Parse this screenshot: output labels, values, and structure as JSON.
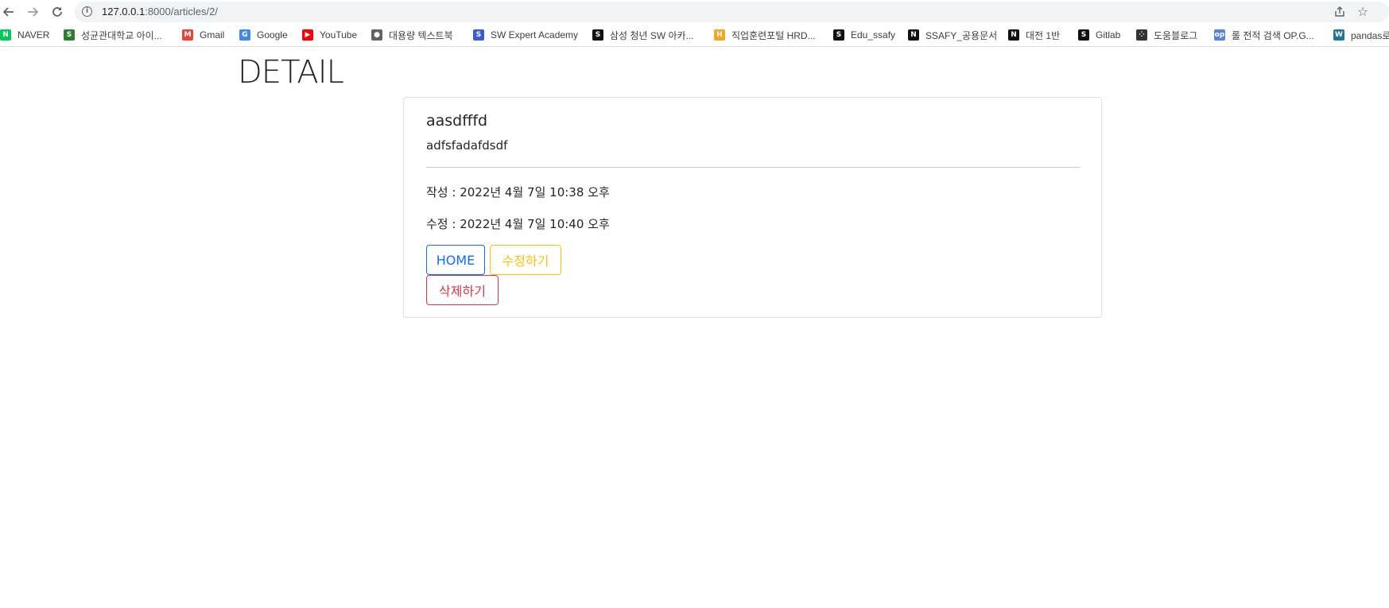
{
  "browser": {
    "url_host": "127.0.0.1",
    "url_path": ":8000/articles/2/",
    "bookmarks": [
      {
        "label": "NAVER",
        "icon": "naver-icon",
        "color": "#03c75a",
        "glyph": "N"
      },
      {
        "label": "성균관대학교 아이...",
        "icon": "skku-icon",
        "color": "#2e7d32",
        "glyph": "S"
      },
      {
        "label": "Gmail",
        "icon": "gmail-icon",
        "color": "#ea4335",
        "glyph": "M"
      },
      {
        "label": "Google",
        "icon": "google-icon",
        "color": "#4285f4",
        "glyph": "G"
      },
      {
        "label": "YouTube",
        "icon": "youtube-icon",
        "color": "#ff0000",
        "glyph": "▶"
      },
      {
        "label": "대용량 텍스트북",
        "icon": "globe-icon",
        "color": "#5f6368",
        "glyph": "●"
      },
      {
        "label": "SW Expert Academy",
        "icon": "swea-icon",
        "color": "#3b5bdb",
        "glyph": "S"
      },
      {
        "label": "삼성 청년 SW 아카...",
        "icon": "ssafy-icon",
        "color": "#111111",
        "glyph": "S"
      },
      {
        "label": "직업훈련포털 HRD...",
        "icon": "hrd-icon",
        "color": "#f5a623",
        "glyph": "H"
      },
      {
        "label": "Edu_ssafy",
        "icon": "edu-ssafy-icon",
        "color": "#111111",
        "glyph": "S"
      },
      {
        "label": "SSAFY_공용문서",
        "icon": "notion-icon",
        "color": "#111111",
        "glyph": "N"
      },
      {
        "label": "대전 1반",
        "icon": "notion-icon",
        "color": "#111111",
        "glyph": "N"
      },
      {
        "label": "Gitlab",
        "icon": "gitlab-icon",
        "color": "#111111",
        "glyph": "S"
      },
      {
        "label": "도움블로그",
        "icon": "tistory-icon",
        "color": "#333333",
        "glyph": "⁘"
      },
      {
        "label": "롤 전적 검색 OP.G...",
        "icon": "opgg-icon",
        "color": "#5383e8",
        "glyph": "op"
      },
      {
        "label": "pandas로",
        "icon": "wordpress-icon",
        "color": "#21759b",
        "glyph": "W"
      }
    ]
  },
  "page": {
    "heading": "DETAIL"
  },
  "article": {
    "title": "aasdfffd",
    "content": "adfsfadafdsdf",
    "created": "작성 : 2022년 4월 7일 10:38 오후",
    "updated": "수정 : 2022년 4월 7일 10:40 오후"
  },
  "buttons": {
    "home": "HOME",
    "edit": "수정하기",
    "delete": "삭제하기"
  }
}
